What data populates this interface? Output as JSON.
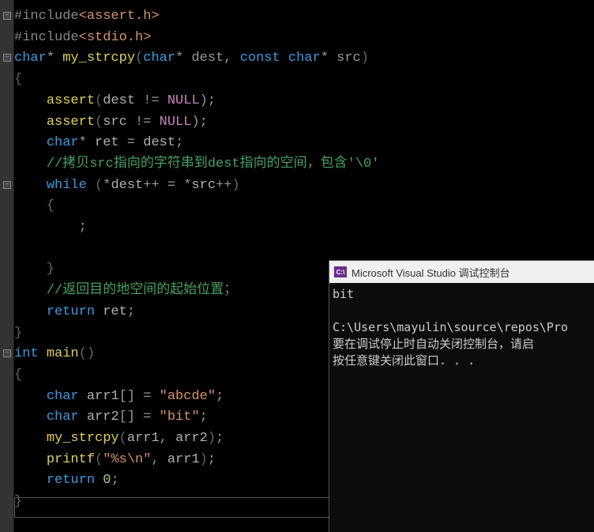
{
  "code": {
    "lines": [
      {
        "spans": [
          {
            "t": "#include",
            "c": "incl"
          },
          {
            "t": "<assert.h>",
            "c": "str"
          }
        ]
      },
      {
        "spans": [
          {
            "t": "#include",
            "c": "incl"
          },
          {
            "t": "<stdio.h>",
            "c": "str"
          }
        ]
      },
      {
        "spans": [
          {
            "t": "char",
            "c": "type"
          },
          {
            "t": "* ",
            "c": "punct"
          },
          {
            "t": "my_strcpy",
            "c": "fn"
          },
          {
            "t": "(",
            "c": "brace"
          },
          {
            "t": "char",
            "c": "type"
          },
          {
            "t": "* ",
            "c": "punct"
          },
          {
            "t": "dest",
            "c": "param"
          },
          {
            "t": ", ",
            "c": "punct"
          },
          {
            "t": "const",
            "c": "kw"
          },
          {
            "t": " ",
            "c": ""
          },
          {
            "t": "char",
            "c": "type"
          },
          {
            "t": "* ",
            "c": "punct"
          },
          {
            "t": "src",
            "c": "param"
          },
          {
            "t": ")",
            "c": "brace"
          }
        ]
      },
      {
        "spans": [
          {
            "t": "{",
            "c": "brace"
          }
        ]
      },
      {
        "spans": [
          {
            "t": "    ",
            "c": ""
          },
          {
            "t": "assert",
            "c": "fn"
          },
          {
            "t": "(",
            "c": "brace"
          },
          {
            "t": "dest",
            "c": "var"
          },
          {
            "t": " != ",
            "c": "op"
          },
          {
            "t": "NULL",
            "c": "null"
          },
          {
            "t": ");",
            "c": "punct"
          }
        ]
      },
      {
        "spans": [
          {
            "t": "    ",
            "c": ""
          },
          {
            "t": "assert",
            "c": "fn"
          },
          {
            "t": "(",
            "c": "brace"
          },
          {
            "t": "src",
            "c": "var"
          },
          {
            "t": " != ",
            "c": "op"
          },
          {
            "t": "NULL",
            "c": "null"
          },
          {
            "t": ");",
            "c": "punct"
          }
        ]
      },
      {
        "spans": [
          {
            "t": "    ",
            "c": ""
          },
          {
            "t": "char",
            "c": "type"
          },
          {
            "t": "* ",
            "c": "punct"
          },
          {
            "t": "ret",
            "c": "var"
          },
          {
            "t": " = ",
            "c": "op"
          },
          {
            "t": "dest",
            "c": "var"
          },
          {
            "t": ";",
            "c": "punct"
          }
        ]
      },
      {
        "spans": [
          {
            "t": "    ",
            "c": ""
          },
          {
            "t": "//拷贝src指向的字符串到dest指向的空间，包含'\\0'",
            "c": "comment"
          }
        ]
      },
      {
        "spans": [
          {
            "t": "    ",
            "c": ""
          },
          {
            "t": "while",
            "c": "kw"
          },
          {
            "t": " (",
            "c": "brace"
          },
          {
            "t": "*",
            "c": "op"
          },
          {
            "t": "dest",
            "c": "var"
          },
          {
            "t": "++ = *",
            "c": "op"
          },
          {
            "t": "src",
            "c": "var"
          },
          {
            "t": "++",
            "c": "op"
          },
          {
            "t": ")",
            "c": "brace"
          }
        ]
      },
      {
        "spans": [
          {
            "t": "    {",
            "c": "brace"
          }
        ]
      },
      {
        "spans": [
          {
            "t": "        ;",
            "c": "punct"
          }
        ]
      },
      {
        "spans": [
          {
            "t": "        ",
            "c": ""
          }
        ]
      },
      {
        "spans": [
          {
            "t": "    }",
            "c": "brace"
          }
        ]
      },
      {
        "spans": [
          {
            "t": "    ",
            "c": ""
          },
          {
            "t": "//返回目的地空间的起始位置；",
            "c": "comment"
          }
        ]
      },
      {
        "spans": [
          {
            "t": "    ",
            "c": ""
          },
          {
            "t": "return",
            "c": "kw"
          },
          {
            "t": " ",
            "c": ""
          },
          {
            "t": "ret",
            "c": "var"
          },
          {
            "t": ";",
            "c": "punct"
          }
        ]
      },
      {
        "spans": [
          {
            "t": "}",
            "c": "brace"
          }
        ]
      },
      {
        "spans": [
          {
            "t": "int",
            "c": "type"
          },
          {
            "t": " ",
            "c": ""
          },
          {
            "t": "main",
            "c": "fn"
          },
          {
            "t": "()",
            "c": "brace"
          }
        ]
      },
      {
        "spans": [
          {
            "t": "{",
            "c": "brace"
          }
        ]
      },
      {
        "spans": [
          {
            "t": "    ",
            "c": ""
          },
          {
            "t": "char",
            "c": "type"
          },
          {
            "t": " ",
            "c": ""
          },
          {
            "t": "arr1",
            "c": "var"
          },
          {
            "t": "[] = ",
            "c": "punct"
          },
          {
            "t": "\"abcde\"",
            "c": "str"
          },
          {
            "t": ";",
            "c": "punct"
          }
        ]
      },
      {
        "spans": [
          {
            "t": "    ",
            "c": ""
          },
          {
            "t": "char",
            "c": "type"
          },
          {
            "t": " ",
            "c": ""
          },
          {
            "t": "arr2",
            "c": "var"
          },
          {
            "t": "[] = ",
            "c": "punct"
          },
          {
            "t": "\"bit\"",
            "c": "str"
          },
          {
            "t": ";",
            "c": "punct"
          }
        ]
      },
      {
        "spans": [
          {
            "t": "    ",
            "c": ""
          },
          {
            "t": "my_strcpy",
            "c": "fn"
          },
          {
            "t": "(",
            "c": "brace"
          },
          {
            "t": "arr1",
            "c": "var"
          },
          {
            "t": ", ",
            "c": "punct"
          },
          {
            "t": "arr2",
            "c": "var"
          },
          {
            "t": ")",
            "c": "brace"
          },
          {
            "t": ";",
            "c": "punct"
          }
        ]
      },
      {
        "spans": [
          {
            "t": "    ",
            "c": ""
          },
          {
            "t": "printf",
            "c": "fn"
          },
          {
            "t": "(",
            "c": "brace"
          },
          {
            "t": "\"%s\\n\"",
            "c": "str"
          },
          {
            "t": ", ",
            "c": "punct"
          },
          {
            "t": "arr1",
            "c": "var"
          },
          {
            "t": ")",
            "c": "brace"
          },
          {
            "t": ";",
            "c": "punct"
          }
        ]
      },
      {
        "spans": [
          {
            "t": "    ",
            "c": ""
          },
          {
            "t": "return",
            "c": "kw"
          },
          {
            "t": " ",
            "c": ""
          },
          {
            "t": "0",
            "c": "num"
          },
          {
            "t": ";",
            "c": "punct"
          }
        ]
      },
      {
        "spans": [
          {
            "t": "}",
            "c": "brace"
          }
        ]
      }
    ]
  },
  "folds": [
    {
      "line": 0,
      "sym": "−"
    },
    {
      "line": 2,
      "sym": "−"
    },
    {
      "line": 8,
      "sym": "−"
    },
    {
      "line": 16,
      "sym": "−"
    }
  ],
  "console": {
    "icon_text": "C:\\",
    "title": "Microsoft Visual Studio 调试控制台",
    "output": "bit\n\nC:\\Users\\mayulin\\source\\repos\\Pro\n要在调试停止时自动关闭控制台，请启\n按任意键关闭此窗口. . ."
  }
}
